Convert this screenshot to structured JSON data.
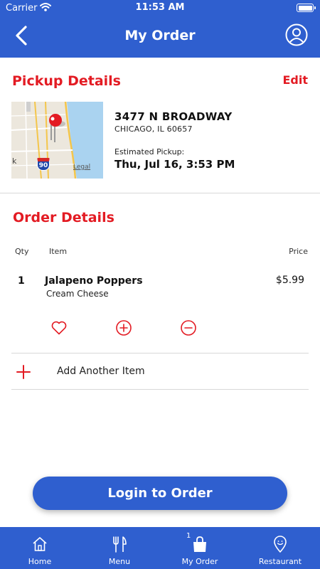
{
  "status_bar": {
    "carrier": "Carrier",
    "time": "11:53 AM"
  },
  "nav": {
    "title": "My Order",
    "back_icon": "chevron-left-icon",
    "profile_icon": "user-circle-icon"
  },
  "pickup": {
    "title": "Pickup Details",
    "edit_label": "Edit",
    "map": {
      "highway_shield": "90",
      "legal": "Legal",
      "partial_label": "k"
    },
    "address_line1": "3477 N BROADWAY",
    "address_line2": "CHICAGO, IL 60657",
    "estimated_label": "Estimated Pickup:",
    "estimated_time": "Thu, Jul 16, 3:53 PM"
  },
  "order": {
    "title": "Order Details",
    "columns": {
      "qty": "Qty",
      "item": "Item",
      "price": "Price"
    },
    "items": [
      {
        "qty": "1",
        "name": "Jalapeno Poppers",
        "modifier": "Cream Cheese",
        "price": "$5.99"
      }
    ],
    "add_item_label": "Add Another Item"
  },
  "login_button": "Login to Order",
  "tabs": [
    {
      "label": "Home",
      "icon": "home-icon"
    },
    {
      "label": "Menu",
      "icon": "fork-knife-icon"
    },
    {
      "label": "My Order",
      "icon": "bag-icon",
      "badge": "1"
    },
    {
      "label": "Restaurant",
      "icon": "location-pin-icon"
    }
  ],
  "colors": {
    "brand_blue": "#2f5fcf",
    "accent_red": "#e31b23"
  }
}
